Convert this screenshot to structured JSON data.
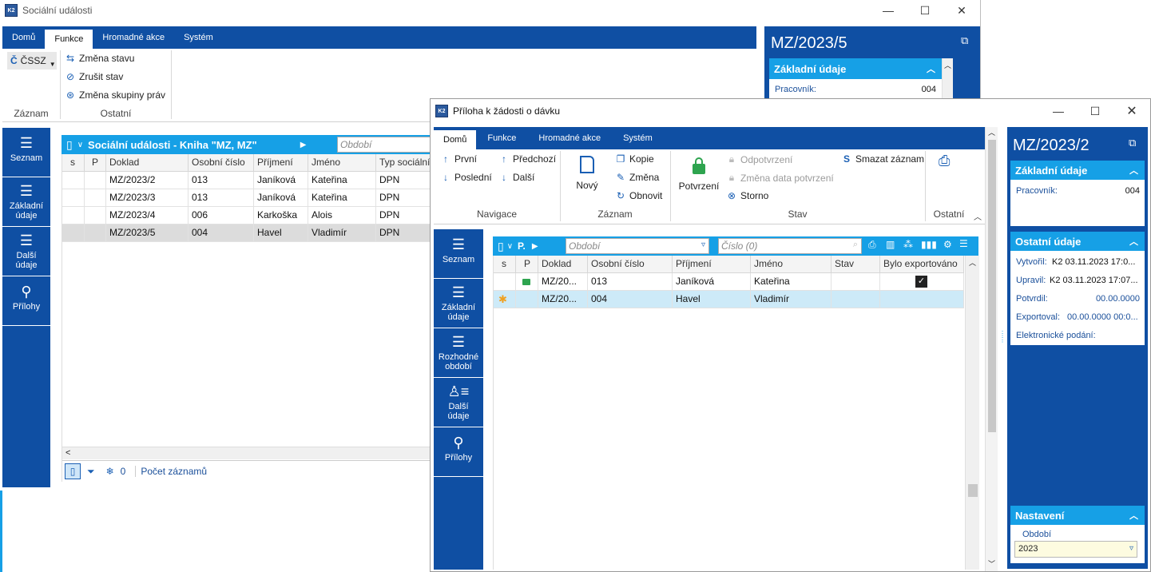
{
  "back_window": {
    "title": "Sociální události",
    "ribbon_tabs": [
      "Domů",
      "Funkce",
      "Hromadné akce",
      "Systém"
    ],
    "active_tab": "Funkce",
    "ribbon": {
      "cssz_label": "ČSSZ",
      "cssz_icon_letter": "Č",
      "btn_zmena_stavu": "Změna stavu",
      "btn_zrusit_stav": "Zrušit stav",
      "btn_zmena_skupiny": "Změna skupiny práv",
      "group_zaznam": "Záznam",
      "group_ostatni": "Ostatní"
    },
    "nav": [
      "Seznam",
      "Základní údaje",
      "Další údaje",
      "Přílohy"
    ],
    "grid_title": "Sociální události - Kniha \"MZ, MZ\"",
    "period_placeholder": "Období",
    "columns": [
      "s",
      "P",
      "Doklad",
      "Osobní číslo",
      "Příjmení",
      "Jméno",
      "Typ sociální"
    ],
    "rows": [
      {
        "doklad": "MZ/2023/2",
        "cislo": "013",
        "prijmeni": "Janíková",
        "jmeno": "Kateřina",
        "typ": "DPN"
      },
      {
        "doklad": "MZ/2023/3",
        "cislo": "013",
        "prijmeni": "Janíková",
        "jmeno": "Kateřina",
        "typ": "DPN"
      },
      {
        "doklad": "MZ/2023/4",
        "cislo": "006",
        "prijmeni": "Karkoška",
        "jmeno": "Alois",
        "typ": "DPN"
      },
      {
        "doklad": "MZ/2023/5",
        "cislo": "004",
        "prijmeni": "Havel",
        "jmeno": "Vladimír",
        "typ": "DPN"
      }
    ],
    "footer_count": "0",
    "footer_label": "Počet záznamů",
    "right": {
      "doc_title": "MZ/2023/5",
      "section_basic": "Základní údaje",
      "pracovnik_label": "Pracovník:",
      "pracovnik_value": "004"
    }
  },
  "front_window": {
    "title": "Příloha k žádosti o dávku",
    "ribbon_tabs": [
      "Domů",
      "Funkce",
      "Hromadné akce",
      "Systém"
    ],
    "active_tab": "Domů",
    "ribbon": {
      "prvni": "První",
      "posledni": "Poslední",
      "predchozi": "Předchozí",
      "dalsi": "Další",
      "novy": "Nový",
      "kopie": "Kopie",
      "zmena": "Změna",
      "obnovit": "Obnovit",
      "potvrzeni": "Potvrzení",
      "odpotvrzeni": "Odpotvrzení",
      "zmena_data": "Změna data potvrzení",
      "storno": "Storno",
      "smazat": "Smazat záznam",
      "group_navigace": "Navigace",
      "group_zaznam": "Záznam",
      "group_stav": "Stav",
      "group_ostatni": "Ostatní"
    },
    "nav": [
      "Seznam",
      "Základní údaje",
      "Rozhodné období",
      "Další údaje",
      "Přílohy"
    ],
    "toolbar": {
      "p_label": "P.",
      "period_placeholder": "Období",
      "number_placeholder": "Číslo (0)"
    },
    "columns": [
      "s",
      "P",
      "Doklad",
      "Osobní číslo",
      "Příjmení",
      "Jméno",
      "Stav",
      "Bylo exportováno"
    ],
    "rows": [
      {
        "doklad": "MZ/20...",
        "cislo": "013",
        "prijmeni": "Janíková",
        "jmeno": "Kateřina",
        "stav": "",
        "exported": true
      },
      {
        "doklad": "MZ/20...",
        "cislo": "004",
        "prijmeni": "Havel",
        "jmeno": "Vladimír",
        "stav": "",
        "exported": false
      }
    ],
    "right": {
      "doc_title": "MZ/2023/2",
      "section_basic": "Základní údaje",
      "pracovnik_label": "Pracovník:",
      "pracovnik_value": "004",
      "section_other": "Ostatní údaje",
      "vytvoril_label": "Vytvořil:",
      "vytvoril_value": "K2 03.11.2023 17:0...",
      "upravil_label": "Upravil:",
      "upravil_value": "K2 03.11.2023 17:07...",
      "potvrdil_label": "Potvrdil:",
      "potvrdil_value": "00.00.0000",
      "exportoval_label": "Exportoval:",
      "exportoval_value": "00.00.0000 00:0...",
      "epodani_label": "Elektronické podání:",
      "section_settings": "Nastavení",
      "obdobi_label": "Období",
      "obdobi_value": "2023"
    }
  },
  "colors": {
    "ribbon_blue": "#0f4fa3",
    "accent_cyan": "#16a0e6",
    "lock_green": "#2ea44f",
    "selected_row": "#cdeaf8"
  }
}
